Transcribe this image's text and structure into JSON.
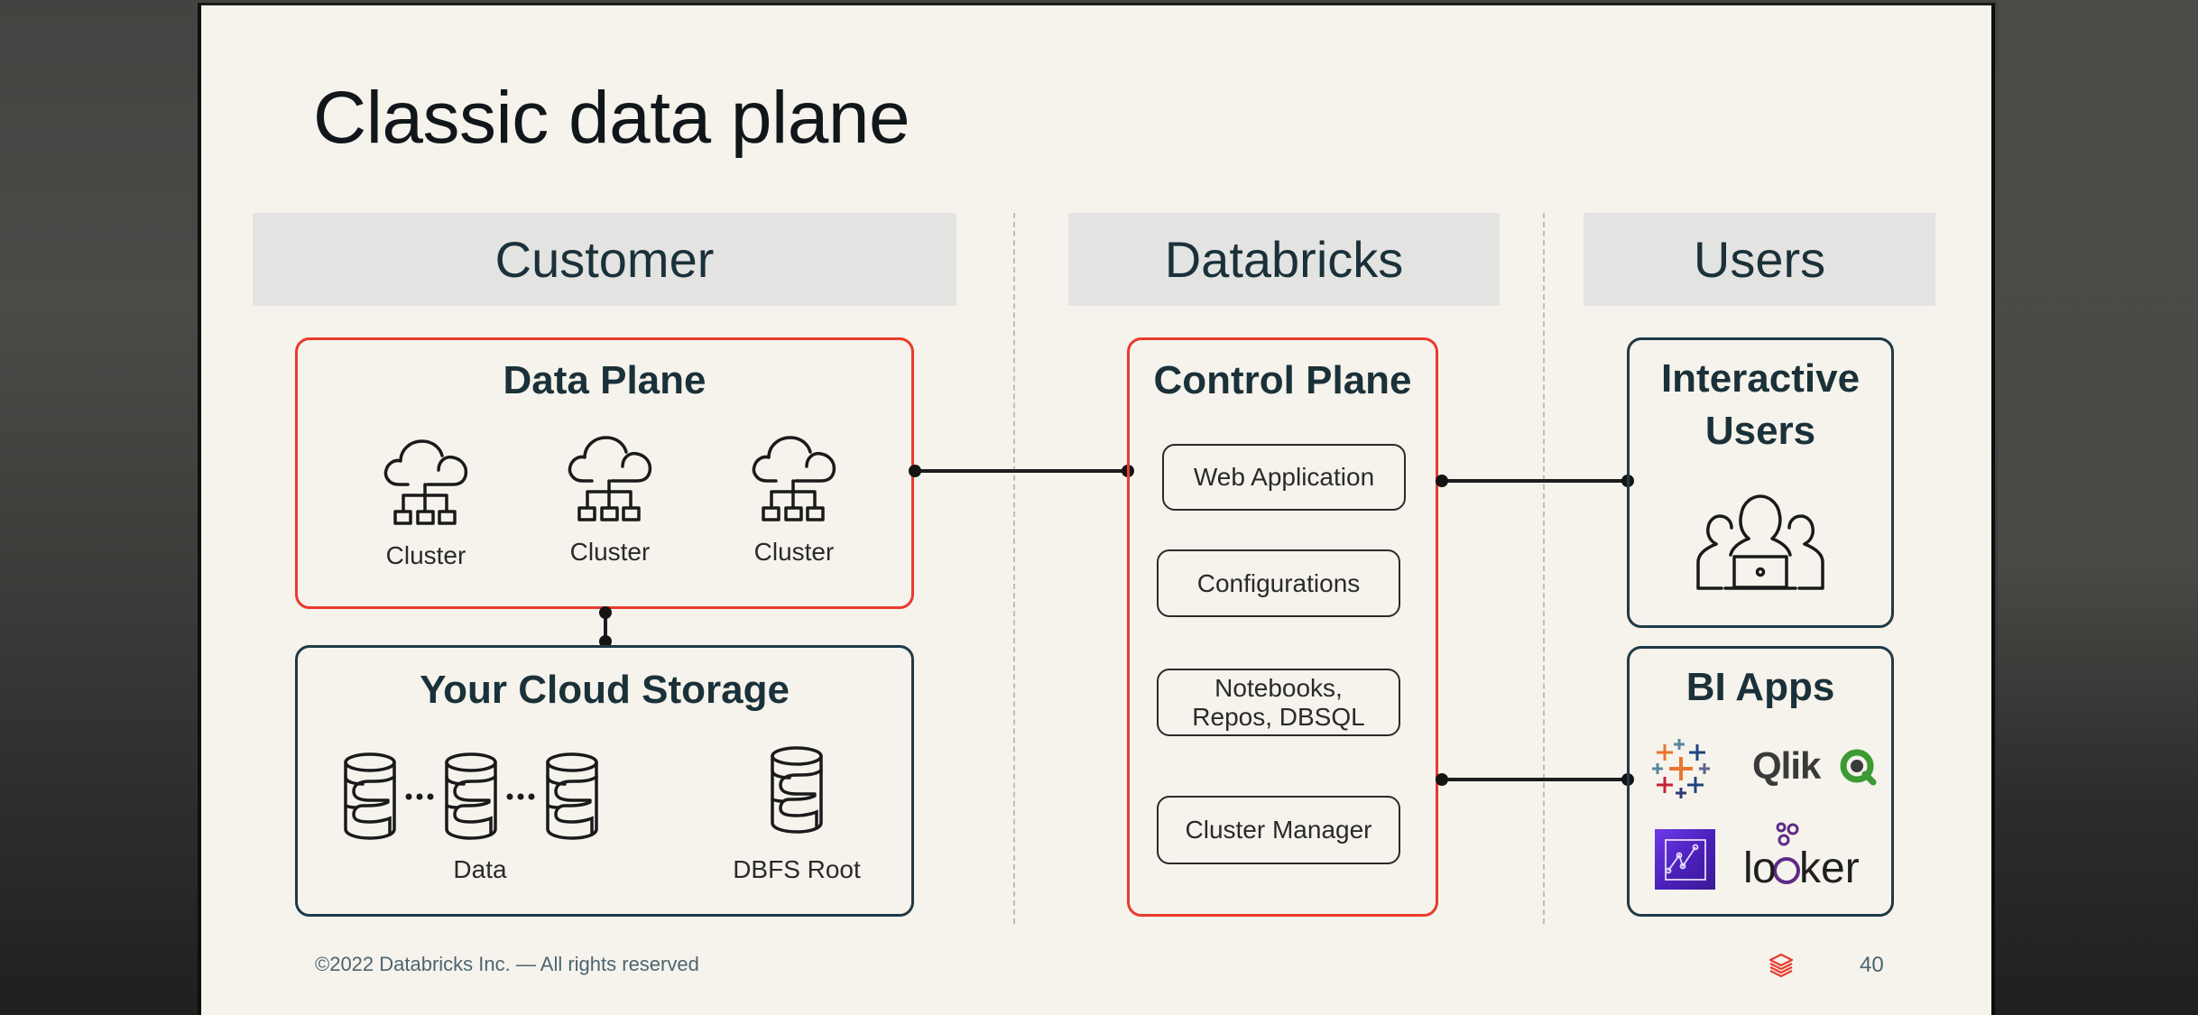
{
  "slide": {
    "title": "Classic data plane",
    "page_number": "40",
    "footer": "©2022 Databricks Inc. — All rights reserved",
    "colors": {
      "background": "#f5f3ec",
      "header_bg": "#e3e3e2",
      "header_text": "#1b3139",
      "accent_red": "#ea3a2d",
      "box_navy": "#1f3a47"
    }
  },
  "columns": [
    {
      "label": "Customer"
    },
    {
      "label": "Databricks"
    },
    {
      "label": "Users"
    }
  ],
  "customer": {
    "data_plane": {
      "title": "Data Plane",
      "clusters": [
        {
          "label": "Cluster",
          "icon": "cloud-cluster-icon"
        },
        {
          "label": "Cluster",
          "icon": "cloud-cluster-icon"
        },
        {
          "label": "Cluster",
          "icon": "cloud-cluster-icon"
        }
      ]
    },
    "cloud_storage": {
      "title": "Your Cloud Storage",
      "data_label": "Data",
      "dbfs_label": "DBFS Root",
      "icon": "database-icon"
    }
  },
  "databricks": {
    "control_plane": {
      "title": "Control Plane",
      "items": [
        {
          "label": "Web Application"
        },
        {
          "label": "Configurations"
        },
        {
          "label": "Notebooks,\nRepos, DBSQL"
        },
        {
          "label": "Cluster Manager"
        }
      ]
    }
  },
  "users": {
    "interactive": {
      "title_line1": "Interactive",
      "title_line2": "Users",
      "icon": "users-laptop-icon"
    },
    "bi_apps": {
      "title": "BI Apps",
      "apps": [
        {
          "name": "Tableau",
          "icon": "tableau-logo"
        },
        {
          "name": "Qlik",
          "icon": "qlik-logo"
        },
        {
          "name": "QuickSight",
          "icon": "quicksight-logo"
        },
        {
          "name": "looker",
          "icon": "looker-logo"
        }
      ]
    }
  }
}
